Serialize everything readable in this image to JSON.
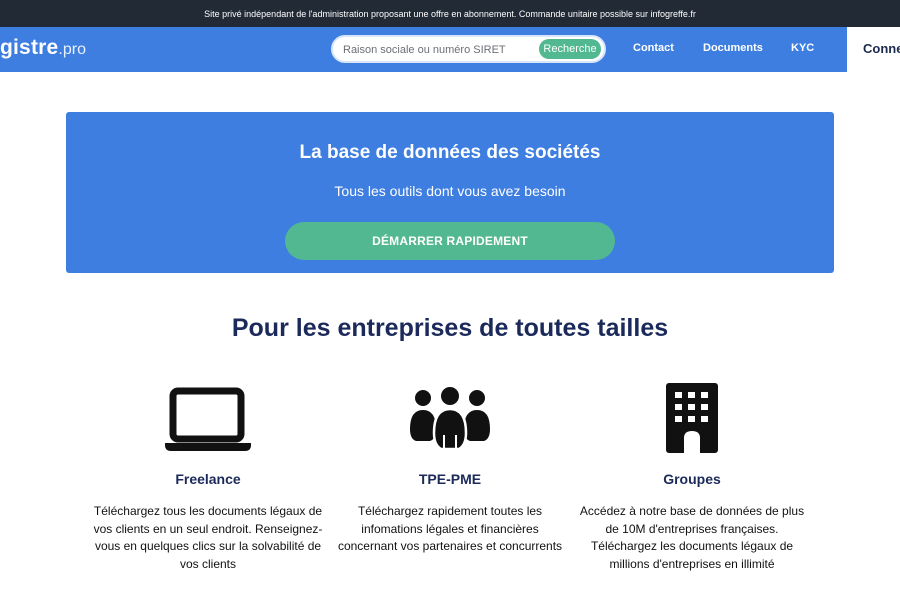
{
  "topbar": {
    "notice": "Site privé indépendant de l'administration proposant une offre en abonnement. Commande unitaire possible sur infogreffe.fr"
  },
  "header": {
    "logo_main": "gistre",
    "logo_suffix": ".pro",
    "search": {
      "placeholder": "Raison sociale ou numéro SIRET",
      "value": "",
      "button_label": "Recherche"
    },
    "nav": {
      "contact": "Contact",
      "documents": "Documents",
      "kyc": "KYC"
    },
    "connect_label": "Connexion"
  },
  "hero": {
    "title": "La base de données des sociétés",
    "subtitle": "Tous les outils dont vous avez besoin",
    "cta_label": "DÉMARRER RAPIDEMENT"
  },
  "section": {
    "title": "Pour les entreprises de toutes tailles"
  },
  "features": [
    {
      "icon": "laptop-icon",
      "title": "Freelance",
      "text": "Téléchargez tous les documents légaux de vos clients en un seul endroit. Renseignez-vous en quelques clics sur la solvabilité de vos clients"
    },
    {
      "icon": "group-icon",
      "title": "TPE-PME",
      "text": "Téléchargez rapidement toutes les infomations légales et financières concernant vos partenaires et concurrents"
    },
    {
      "icon": "building-icon",
      "title": "Groupes",
      "text": "Accédez à notre base de données de plus de 10M d'entreprises françaises. Téléchargez les documents légaux de millions d'entreprises en illimité"
    }
  ],
  "colors": {
    "topbar": "#212a35",
    "brand_blue": "#3d7ee0",
    "accent_green": "#52b891",
    "heading_navy": "#1b2a5a"
  }
}
